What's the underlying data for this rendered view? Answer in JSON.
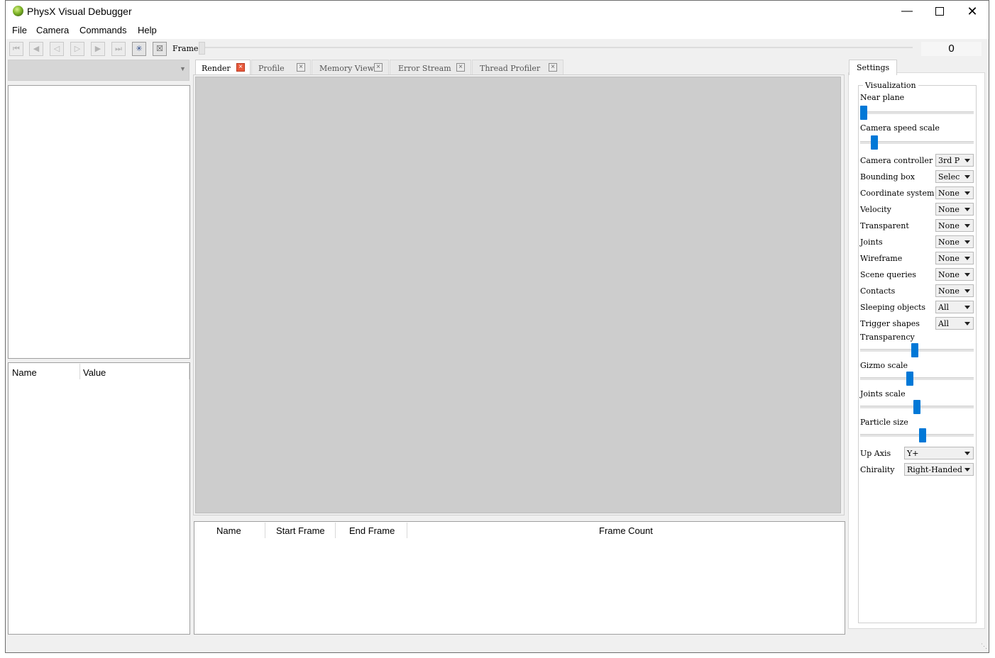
{
  "window": {
    "title": "PhysX Visual Debugger"
  },
  "menu": [
    "File",
    "Camera",
    "Commands",
    "Help"
  ],
  "toolbar": {
    "frame_label": "Frame",
    "frame_count": "0"
  },
  "tabs": [
    {
      "label": "Render",
      "selected": true
    },
    {
      "label": "Profile",
      "selected": false
    },
    {
      "label": "Memory View",
      "selected": false
    },
    {
      "label": "Error Stream",
      "selected": false
    },
    {
      "label": "Thread Profiler",
      "selected": false
    }
  ],
  "props_table": {
    "headers": [
      "Name",
      "Value"
    ]
  },
  "events_table": {
    "headers": [
      "Name",
      "Start Frame",
      "End Frame",
      "Frame Count"
    ]
  },
  "settings": {
    "tab": "Settings",
    "group": "Visualization",
    "near_plane": "Near plane",
    "camera_speed_scale": "Camera speed scale",
    "camera_controller": {
      "label": "Camera controller",
      "value": "3rd P"
    },
    "bounding_box": {
      "label": "Bounding box",
      "value": "Selec"
    },
    "coordinate_system": {
      "label": "Coordinate system",
      "value": "None"
    },
    "velocity": {
      "label": "Velocity",
      "value": "None"
    },
    "transparent": {
      "label": "Transparent",
      "value": "None"
    },
    "joints": {
      "label": "Joints",
      "value": "None"
    },
    "wireframe": {
      "label": "Wireframe",
      "value": "None"
    },
    "scene_queries": {
      "label": "Scene queries",
      "value": "None"
    },
    "contacts": {
      "label": "Contacts",
      "value": "None"
    },
    "sleeping_objects": {
      "label": "Sleeping objects",
      "value": "All"
    },
    "trigger_shapes": {
      "label": "Trigger shapes",
      "value": "All"
    },
    "transparency": "Transparency",
    "gizmo_scale": "Gizmo scale",
    "joints_scale": "Joints scale",
    "particle_size": "Particle size",
    "up_axis": {
      "label": "Up Axis",
      "value": "Y+"
    },
    "chirality": {
      "label": "Chirality",
      "value": "Right-Handed"
    }
  },
  "sliders": {
    "near_plane": 0.0,
    "camera_speed_scale": 0.1,
    "transparency": 0.48,
    "gizmo_scale": 0.43,
    "joints_scale": 0.5,
    "particle_size": 0.55
  },
  "colors": {
    "accent": "#0078d7",
    "tab_close_active": "#e85a3c",
    "viewport": "#cdcdcd"
  }
}
